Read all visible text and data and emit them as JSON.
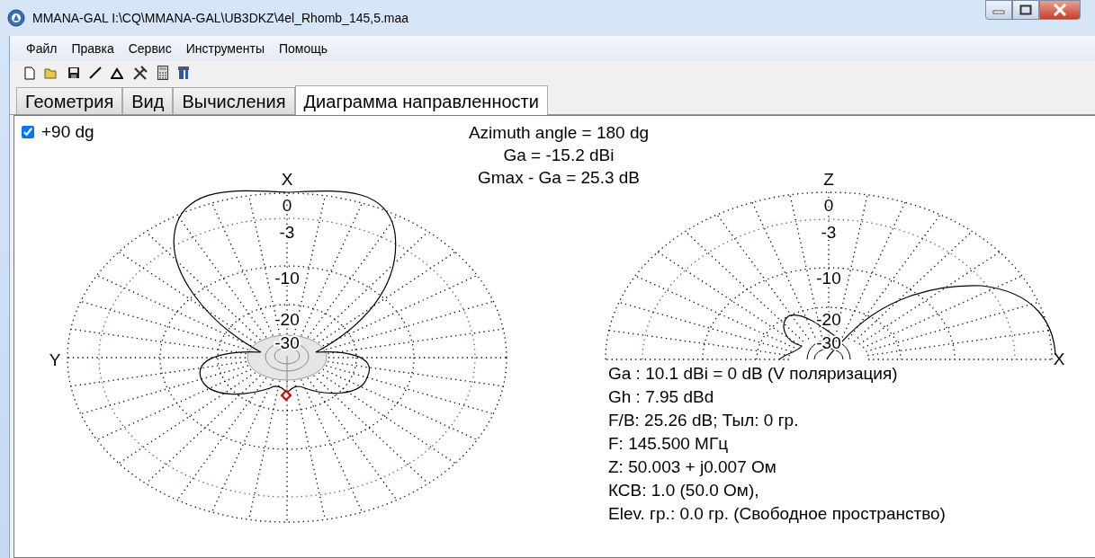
{
  "window": {
    "title": "MMANA-GAL I:\\CQ\\MMANA-GAL\\UB3DKZ\\4el_Rhomb_145,5.maa"
  },
  "menu": [
    "Файл",
    "Правка",
    "Сервис",
    "Инструменты",
    "Помощь"
  ],
  "tabs": [
    {
      "label": "Геометрия",
      "selected": false
    },
    {
      "label": "Вид",
      "selected": false
    },
    {
      "label": "Вычисления",
      "selected": false
    },
    {
      "label": "Диаграмма направленности",
      "selected": true
    }
  ],
  "option": {
    "label": "+90 dg",
    "checked": true
  },
  "header_lines": [
    "Azimuth angle = 180 dg",
    "Ga = -15.2 dBi",
    "Gmax - Ga = 25.3 dB"
  ],
  "azimuth_plot": {
    "axis_top": "X",
    "axis_side": "Y",
    "ring_labels": [
      "0",
      "-3",
      "-10",
      "-20",
      "-30"
    ]
  },
  "elevation_plot": {
    "axis_top": "Z",
    "axis_side": "X",
    "ring_labels": [
      "0",
      "-3",
      "-10",
      "-20",
      "-30"
    ]
  },
  "results": [
    "Ga : 10.1 dBi = 0 dB  (V поляризация)",
    "Gh : 7.95 dBd",
    "F/B: 25.26 dB; Тыл: 0 гр.",
    "F: 145.500 МГц",
    "Z: 50.003 + j0.007 Ом",
    "КСВ: 1.0 (50.0 Ом),",
    "Elev. гр.: 0.0 гр. (Свободное пространство)"
  ]
}
